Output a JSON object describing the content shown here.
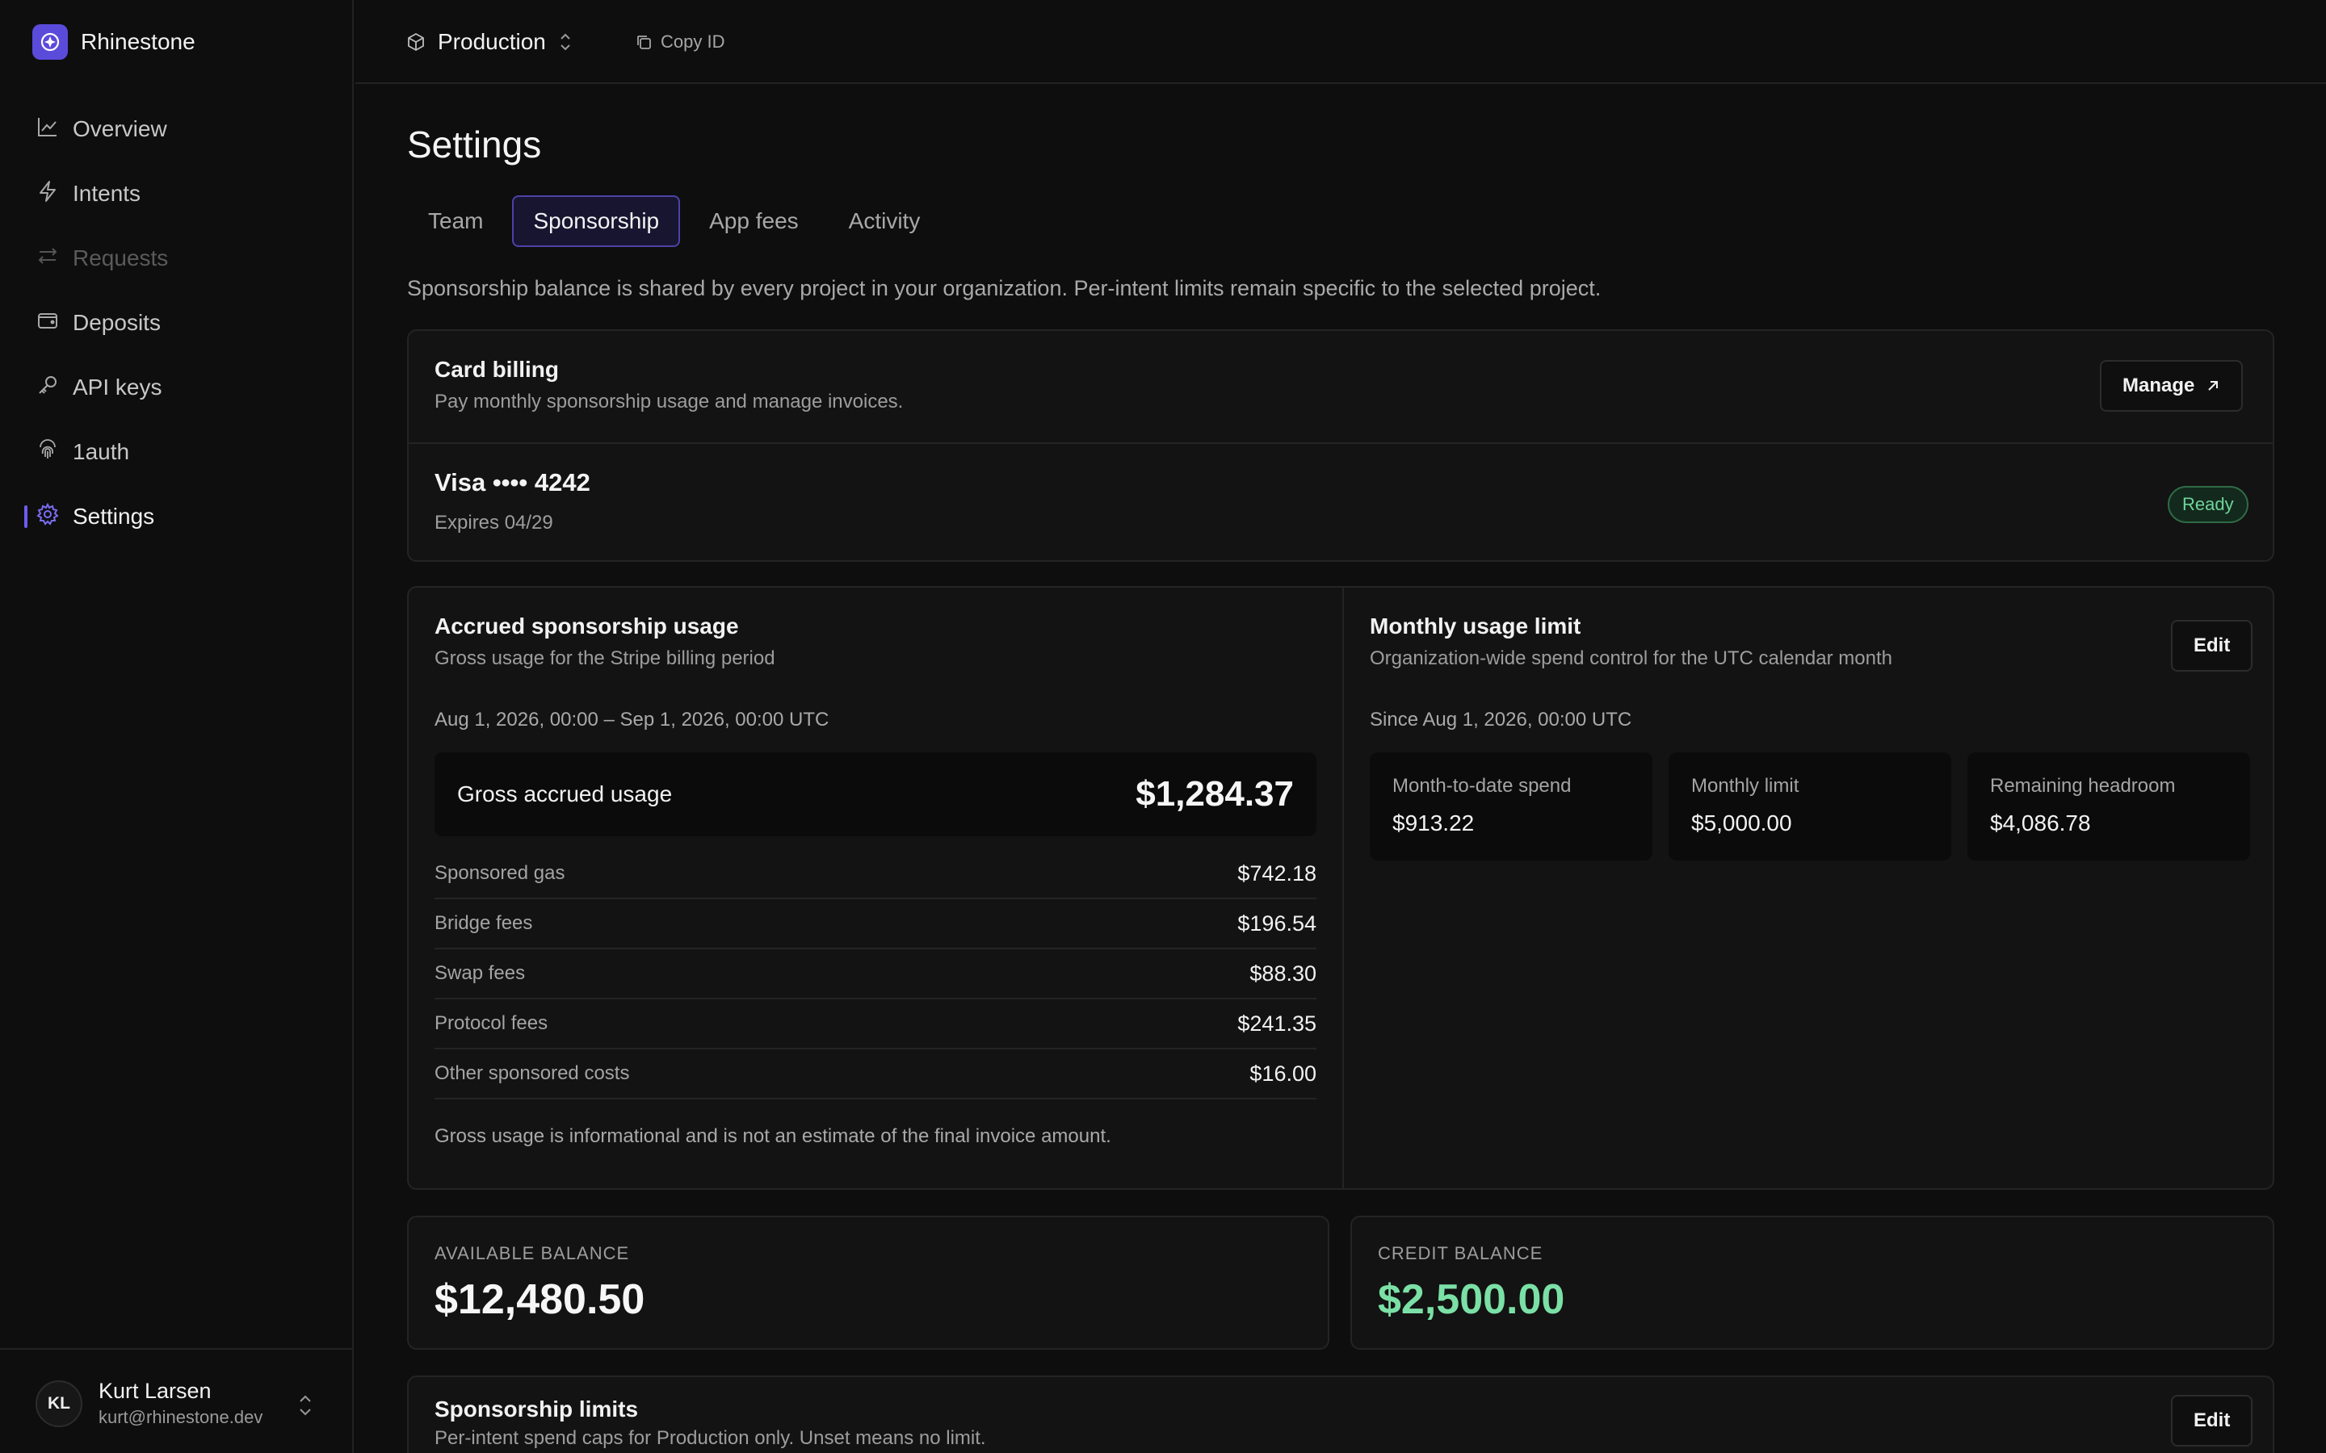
{
  "brand": {
    "name": "Rhinestone"
  },
  "nav": {
    "items": [
      {
        "label": "Overview",
        "icon": "chart-line-icon"
      },
      {
        "label": "Intents",
        "icon": "bolt-icon"
      },
      {
        "label": "Requests",
        "icon": "arrows-swap-icon",
        "disabled": true
      },
      {
        "label": "Deposits",
        "icon": "wallet-icon"
      },
      {
        "label": "API keys",
        "icon": "key-icon"
      },
      {
        "label": "1auth",
        "icon": "fingerprint-icon"
      },
      {
        "label": "Settings",
        "icon": "gear-icon",
        "active": true
      }
    ]
  },
  "user": {
    "initials": "KL",
    "name": "Kurt Larsen",
    "email": "kurt@rhinestone.dev"
  },
  "topbar": {
    "project": "Production",
    "copy_id_label": "Copy ID"
  },
  "page": {
    "title": "Settings",
    "tabs": [
      {
        "label": "Team"
      },
      {
        "label": "Sponsorship",
        "active": true
      },
      {
        "label": "App fees"
      },
      {
        "label": "Activity"
      }
    ],
    "intro": "Sponsorship balance is shared by every project in your organization. Per-intent limits remain specific to the selected project."
  },
  "billing": {
    "title": "Card billing",
    "subtitle": "Pay monthly sponsorship usage and manage invoices.",
    "manage_label": "Manage",
    "card": "Visa •••• 4242",
    "expires": "Expires 04/29",
    "status": "Ready"
  },
  "accrued": {
    "title": "Accrued sponsorship usage",
    "subtitle": "Gross usage for the Stripe billing period",
    "period": "Aug 1, 2026, 00:00 – Sep 1, 2026, 00:00 UTC",
    "gross_label": "Gross accrued usage",
    "gross_value": "$1,284.37",
    "lines": [
      {
        "label": "Sponsored gas",
        "value": "$742.18"
      },
      {
        "label": "Bridge fees",
        "value": "$196.54"
      },
      {
        "label": "Swap fees",
        "value": "$88.30"
      },
      {
        "label": "Protocol fees",
        "value": "$241.35"
      },
      {
        "label": "Other sponsored costs",
        "value": "$16.00"
      }
    ],
    "note": "Gross usage is informational and is not an estimate of the final invoice amount."
  },
  "monthly_limit": {
    "title": "Monthly usage limit",
    "subtitle": "Organization-wide spend control for the UTC calendar month",
    "edit_label": "Edit",
    "since": "Since Aug 1, 2026, 00:00 UTC",
    "stats": [
      {
        "label": "Month-to-date spend",
        "value": "$913.22"
      },
      {
        "label": "Monthly limit",
        "value": "$5,000.00"
      },
      {
        "label": "Remaining headroom",
        "value": "$4,086.78"
      }
    ]
  },
  "balances": {
    "available_label": "AVAILABLE BALANCE",
    "available_value": "$12,480.50",
    "credit_label": "CREDIT BALANCE",
    "credit_value": "$2,500.00"
  },
  "limits": {
    "title": "Sponsorship limits",
    "subtitle": "Per-intent spend caps for Production only. Unset means no limit.",
    "edit_label": "Edit"
  },
  "colors": {
    "accent": "#6c5cf0",
    "success": "#7be0a6",
    "background": "#0e0e0e",
    "surface": "#131313"
  }
}
